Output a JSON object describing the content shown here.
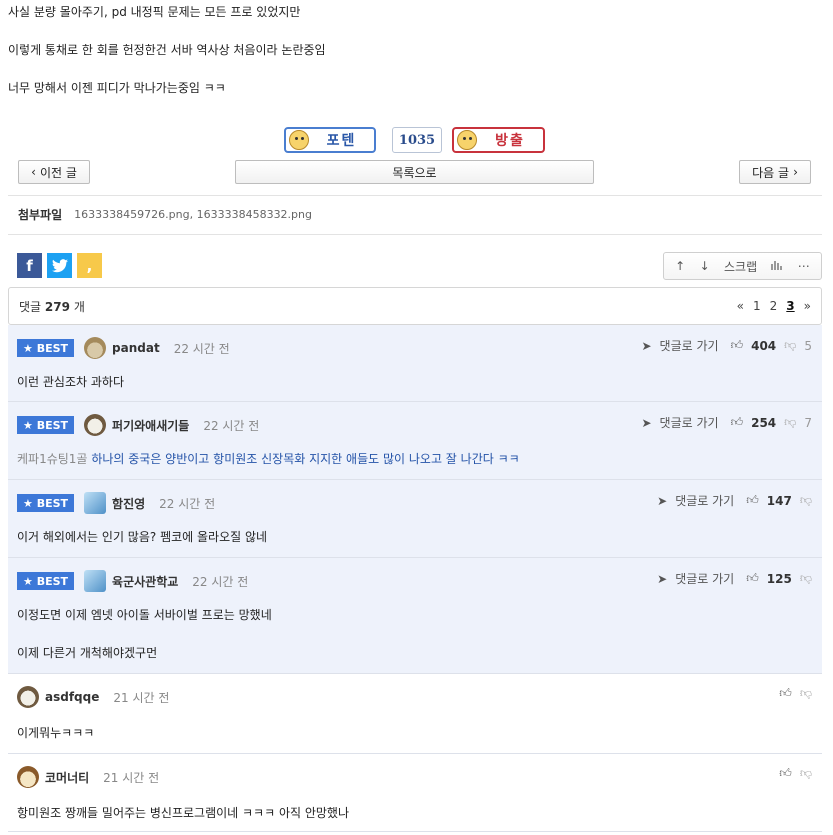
{
  "post": {
    "lines": [
      "사실 분량 몰아주기, pd 내정픽 문제는 모든 프로 있었지만",
      "이렇게 통채로 한 회를 헌정한건 서바 역사상 처음이라 논란중임",
      "너무 망해서 이젠 피디가 막나가는중임 ㅋㅋ"
    ]
  },
  "vote": {
    "up_label": "포텐",
    "count": "1035",
    "down_label": "방출"
  },
  "nav": {
    "prev": "이전 글",
    "list": "목록으로",
    "next": "다음 글"
  },
  "attachments": {
    "label": "첨부파일",
    "files": "1633338459726.png,  1633338458332.png"
  },
  "share": {
    "facebook": "f",
    "twitter": "t",
    "kakao": ","
  },
  "tools": {
    "scrap": "스크랩"
  },
  "comments_header": {
    "prefix": "댓글",
    "count": "279",
    "suffix": "개",
    "pages": [
      "1",
      "2",
      "3"
    ],
    "current_page": "3",
    "first": "«",
    "last": "»"
  },
  "best_label": "BEST",
  "reply_label": "댓글로 가기",
  "comments": [
    {
      "nick": "pandat",
      "time": "22 시간 전",
      "text": "이런 관심조차 과하다",
      "likes": "404",
      "dislikes": "5"
    },
    {
      "nick": "퍼기와애새기들",
      "time": "22 시간 전",
      "prefix": "케파1슈팅1골",
      "text": "하나의 중국은 양반이고 항미원조 신장목화 지지한 애들도 많이 나오고 잘 나간다 ㅋㅋ",
      "likes": "254",
      "dislikes": "7"
    },
    {
      "nick": "함진영",
      "time": "22 시간 전",
      "text": "이거 해외에서는 인기 많음? 펨코에 올라오질 않네",
      "likes": "147",
      "dislikes": ""
    },
    {
      "nick": "육군사관학교",
      "time": "22 시간 전",
      "text": "이정도면 이제 엠넷 아이돌 서바이벌 프로는 망했네",
      "text2": "이제 다른거 개척해야겠구먼",
      "likes": "125",
      "dislikes": ""
    },
    {
      "nick": "asdfqqe",
      "time": "21 시간 전",
      "text": "이게뭐누ㅋㅋㅋ"
    },
    {
      "nick": "코머너티",
      "time": "21 시간 전",
      "text": "항미원조 짱깨들 밀어주는 병신프로그램이네 ㅋㅋㅋ 아직 안망했나"
    }
  ]
}
